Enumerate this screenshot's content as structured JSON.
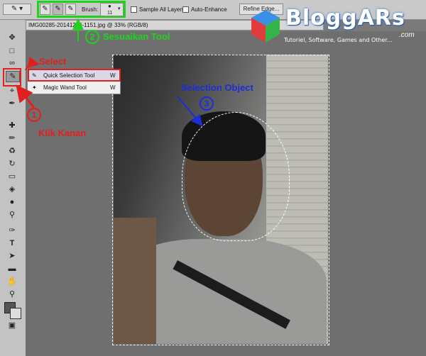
{
  "options_bar": {
    "brush_label": "Brush:",
    "brush_size": "11",
    "sample_all_layers": "Sample All Layers",
    "auto_enhance": "Auto-Enhance",
    "refine_edge": "Refine Edge..."
  },
  "document": {
    "tab_title": "IMG00285-20141216-1151.jpg @ 33% (RGB/8)"
  },
  "context_menu": {
    "items": [
      {
        "label": "Quick Selection Tool",
        "shortcut": "W"
      },
      {
        "label": "Magic Wand Tool",
        "shortcut": "W"
      }
    ]
  },
  "annotations": {
    "select": "Select",
    "klik_kanan": "Klik Kanan",
    "sesuaikan_tool": "Sesuaikan Tool",
    "selection_object": "Selection Object",
    "n1": "1",
    "n2": "2",
    "n3": "3"
  },
  "logo": {
    "name": "BloggARs",
    "tagline": "Tutoriel, Software, Games and Other...",
    "suffix": ".com"
  },
  "colors": {
    "annotation_red": "#e21f1f",
    "annotation_green": "#1bd51b",
    "annotation_blue": "#1a2fd6"
  }
}
